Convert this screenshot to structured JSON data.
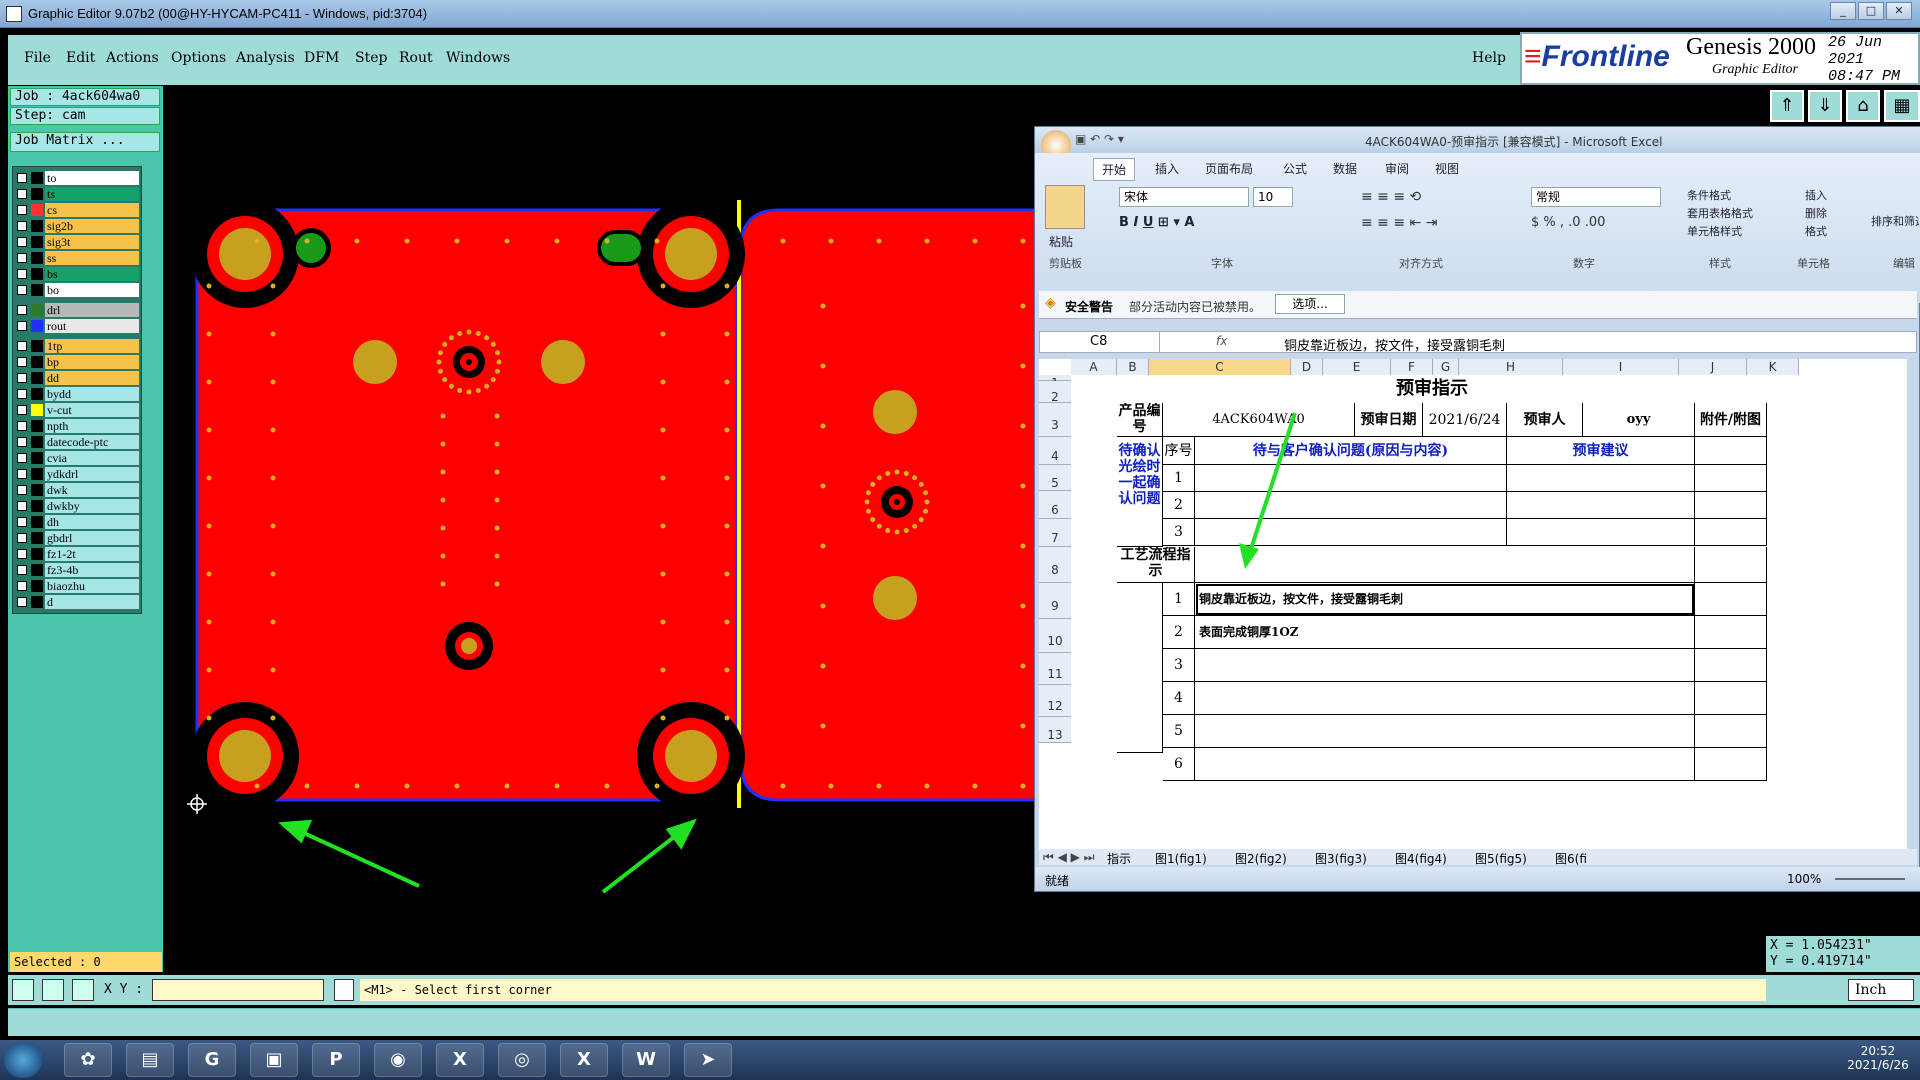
{
  "window": {
    "title": "Graphic Editor 9.07b2 (00@HY-HYCAM-PC411 - Windows, pid:3704)"
  },
  "menu": [
    "File",
    "Edit",
    "Actions",
    "Options",
    "Analysis",
    "DFM",
    "Step",
    "Rout",
    "Windows"
  ],
  "help_label": "Help",
  "logo": {
    "brand": "Frontline",
    "product": "Genesis 2000",
    "subtitle": "Graphic Editor",
    "date_line1": "26 Jun 2021",
    "date_line2": "08:47 PM"
  },
  "job": {
    "job": "Job  : 4ack604wa0",
    "step": "Step: cam",
    "matrix_button": "Job Matrix ..."
  },
  "layers": [
    {
      "name": "to",
      "color": "#ffffff"
    },
    {
      "name": "ts",
      "color": "#18a06a"
    },
    {
      "name": "cs",
      "color": "#f6c24a"
    },
    {
      "name": "sig2b",
      "color": "#f6c24a"
    },
    {
      "name": "sig3t",
      "color": "#f6c24a"
    },
    {
      "name": "ss",
      "color": "#f6c24a"
    },
    {
      "name": "bs",
      "color": "#18a06a"
    },
    {
      "name": "bo",
      "color": "#ffffff"
    },
    {
      "name": "drl",
      "color": "#b8b8b8"
    },
    {
      "name": "rout",
      "color": "#e8e8e8"
    },
    {
      "name": "1tp",
      "color": "#f6c24a"
    },
    {
      "name": "bp",
      "color": "#f6c24a"
    },
    {
      "name": "dd",
      "color": "#f6c24a"
    },
    {
      "name": "bydd",
      "color": "#a6e6e6"
    },
    {
      "name": "v-cut",
      "color": "#a6e6e6"
    },
    {
      "name": "npth",
      "color": "#a6e6e6"
    },
    {
      "name": "datecode-ptc",
      "color": "#a6e6e6"
    },
    {
      "name": "cvia",
      "color": "#a6e6e6"
    },
    {
      "name": "ydkdrl",
      "color": "#a6e6e6"
    },
    {
      "name": "dwk",
      "color": "#a6e6e6"
    },
    {
      "name": "dwkby",
      "color": "#a6e6e6"
    },
    {
      "name": "dh",
      "color": "#a6e6e6"
    },
    {
      "name": "gbdrl",
      "color": "#a6e6e6"
    },
    {
      "name": "fz1-2t",
      "color": "#a6e6e6"
    },
    {
      "name": "fz3-4b",
      "color": "#a6e6e6"
    },
    {
      "name": "biaozhu",
      "color": "#a6e6e6"
    },
    {
      "name": "d",
      "color": "#a6e6e6"
    }
  ],
  "selected": "Selected : 0",
  "xy_label": "X Y :",
  "xy_value": "",
  "prompt": "<M1> - Select first corner",
  "coords": {
    "x": "X = 1.054231\"",
    "y": "Y = 0.419714\""
  },
  "units": "Inch",
  "excel": {
    "title": "4ACK604WA0-预审指示 [兼容模式] - Microsoft Excel",
    "tabs": [
      "开始",
      "插入",
      "页面布局",
      "公式",
      "数据",
      "审阅",
      "视图"
    ],
    "font_name": "宋体",
    "font_size": "10",
    "number_format": "常规",
    "groups": [
      "剪贴板",
      "字体",
      "对齐方式",
      "数字",
      "样式",
      "单元格",
      "编辑"
    ],
    "ribbon_buttons": [
      "粘贴",
      "条件格式",
      "套用表格格式",
      "单元格样式",
      "插入",
      "删除",
      "格式",
      "排序和筛选"
    ],
    "security": {
      "label": "安全警告",
      "text": "部分活动内容已被禁用。",
      "button": "选项..."
    },
    "name_box": "C8",
    "formula": "铜皮靠近板边，按文件，接受露铜毛刺",
    "columns": [
      "A",
      "B",
      "C",
      "D",
      "E",
      "F",
      "G",
      "H",
      "I",
      "J",
      "K"
    ],
    "rows": [
      "1",
      "2",
      "3",
      "4",
      "5",
      "6",
      "7",
      "8",
      "9",
      "10",
      "11",
      "12",
      "13"
    ],
    "cells": {
      "title": "预审指示",
      "product_no_label": "产品编号",
      "product_no": "4ACK604WA0",
      "date_label": "预审日期",
      "date": "2021/6/24",
      "reviewer_label": "预审人",
      "reviewer": "oyy",
      "attach_label": "附件/附图",
      "confirm_label": "待确认光绘时一起确认问题",
      "seq_label": "序号",
      "issue_header": "待与客户确认问题(原因与内容)",
      "suggest_header": "预审建议",
      "process_label": "工艺流程指示",
      "n1": "1",
      "n2": "2",
      "n3": "3",
      "n4": "4",
      "n5": "5",
      "n6": "6",
      "p1": "铜皮靠近板边，按文件，接受露铜毛刺",
      "p2": "表面完成铜厚1OZ"
    },
    "sheets": [
      "指示",
      "图1(fig1)",
      "图2(fig2)",
      "图3(fig3)",
      "图4(fig4)",
      "图5(fig5)",
      "图6(fi"
    ],
    "status": "就绪",
    "zoom": "100%"
  },
  "taskbar": {
    "time": "20:52",
    "date": "2021/6/26"
  }
}
